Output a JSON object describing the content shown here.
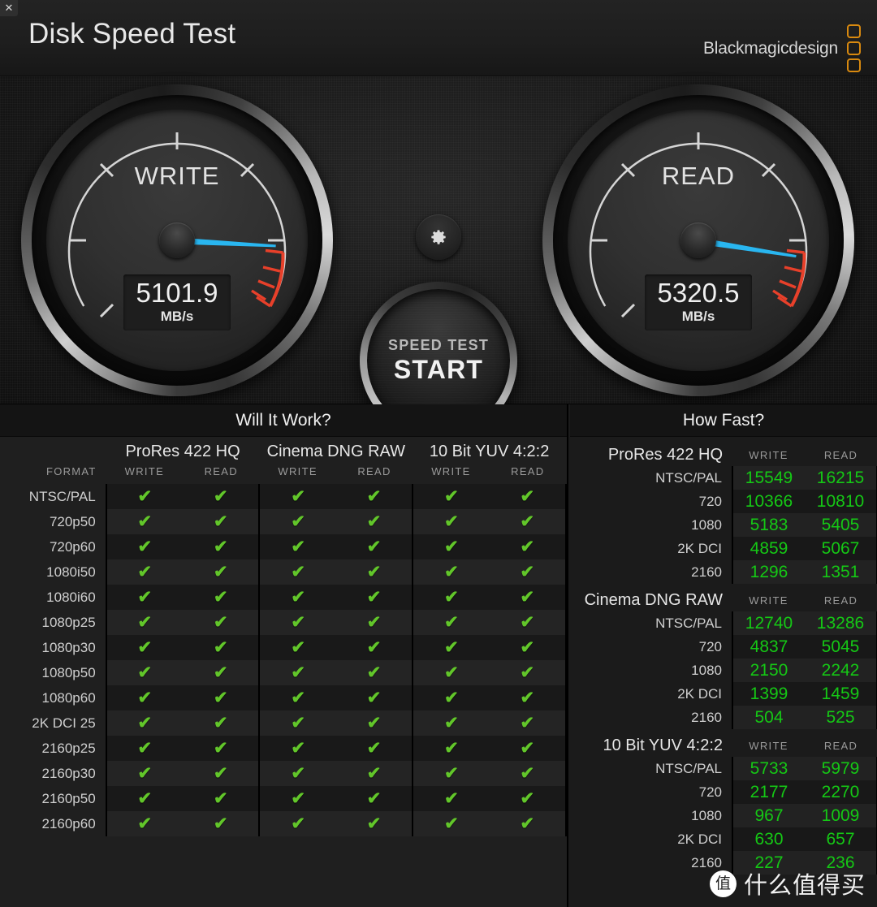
{
  "window": {
    "close_label": "✕"
  },
  "header": {
    "title": "Disk Speed Test",
    "brand": "Blackmagicdesign"
  },
  "gauges": {
    "write": {
      "label": "WRITE",
      "value": "5101.9",
      "unit": "MB/s"
    },
    "read": {
      "label": "READ",
      "value": "5320.5",
      "unit": "MB/s"
    }
  },
  "controls": {
    "settings_icon": "gear-icon",
    "start_line1": "SPEED TEST",
    "start_line2": "START"
  },
  "will_it_work": {
    "title": "Will It Work?",
    "format_header": "FORMAT",
    "groups": [
      {
        "name": "ProRes 422 HQ",
        "write": "WRITE",
        "read": "READ"
      },
      {
        "name": "Cinema DNG RAW",
        "write": "WRITE",
        "read": "READ"
      },
      {
        "name": "10 Bit YUV 4:2:2",
        "write": "WRITE",
        "read": "READ"
      }
    ],
    "check_glyph": "✔",
    "rows": [
      {
        "format": "NTSC/PAL",
        "cells": [
          true,
          true,
          true,
          true,
          true,
          true
        ]
      },
      {
        "format": "720p50",
        "cells": [
          true,
          true,
          true,
          true,
          true,
          true
        ]
      },
      {
        "format": "720p60",
        "cells": [
          true,
          true,
          true,
          true,
          true,
          true
        ]
      },
      {
        "format": "1080i50",
        "cells": [
          true,
          true,
          true,
          true,
          true,
          true
        ]
      },
      {
        "format": "1080i60",
        "cells": [
          true,
          true,
          true,
          true,
          true,
          true
        ]
      },
      {
        "format": "1080p25",
        "cells": [
          true,
          true,
          true,
          true,
          true,
          true
        ]
      },
      {
        "format": "1080p30",
        "cells": [
          true,
          true,
          true,
          true,
          true,
          true
        ]
      },
      {
        "format": "1080p50",
        "cells": [
          true,
          true,
          true,
          true,
          true,
          true
        ]
      },
      {
        "format": "1080p60",
        "cells": [
          true,
          true,
          true,
          true,
          true,
          true
        ]
      },
      {
        "format": "2K DCI 25",
        "cells": [
          true,
          true,
          true,
          true,
          true,
          true
        ]
      },
      {
        "format": "2160p25",
        "cells": [
          true,
          true,
          true,
          true,
          true,
          true
        ]
      },
      {
        "format": "2160p30",
        "cells": [
          true,
          true,
          true,
          true,
          true,
          true
        ]
      },
      {
        "format": "2160p50",
        "cells": [
          true,
          true,
          true,
          true,
          true,
          true
        ]
      },
      {
        "format": "2160p60",
        "cells": [
          true,
          true,
          true,
          true,
          true,
          true
        ]
      }
    ]
  },
  "how_fast": {
    "title": "How Fast?",
    "col_write": "WRITE",
    "col_read": "READ",
    "sections": [
      {
        "name": "ProRes 422 HQ",
        "rows": [
          {
            "label": "NTSC/PAL",
            "write": "15549",
            "read": "16215"
          },
          {
            "label": "720",
            "write": "10366",
            "read": "10810"
          },
          {
            "label": "1080",
            "write": "5183",
            "read": "5405"
          },
          {
            "label": "2K DCI",
            "write": "4859",
            "read": "5067"
          },
          {
            "label": "2160",
            "write": "1296",
            "read": "1351"
          }
        ]
      },
      {
        "name": "Cinema DNG RAW",
        "rows": [
          {
            "label": "NTSC/PAL",
            "write": "12740",
            "read": "13286"
          },
          {
            "label": "720",
            "write": "4837",
            "read": "5045"
          },
          {
            "label": "1080",
            "write": "2150",
            "read": "2242"
          },
          {
            "label": "2K DCI",
            "write": "1399",
            "read": "1459"
          },
          {
            "label": "2160",
            "write": "504",
            "read": "525"
          }
        ]
      },
      {
        "name": "10 Bit YUV 4:2:2",
        "rows": [
          {
            "label": "NTSC/PAL",
            "write": "5733",
            "read": "5979"
          },
          {
            "label": "720",
            "write": "2177",
            "read": "2270"
          },
          {
            "label": "1080",
            "write": "967",
            "read": "1009"
          },
          {
            "label": "2K DCI",
            "write": "630",
            "read": "657"
          },
          {
            "label": "2160",
            "write": "227",
            "read": "236"
          }
        ]
      }
    ]
  },
  "watermark": {
    "badge": "值",
    "text": "什么值得买"
  },
  "colors": {
    "accent_needle": "#29b6f0",
    "redzone": "#e8402a",
    "check_green": "#62c62a",
    "value_green": "#15c815",
    "brand_orange": "#d8890f"
  }
}
